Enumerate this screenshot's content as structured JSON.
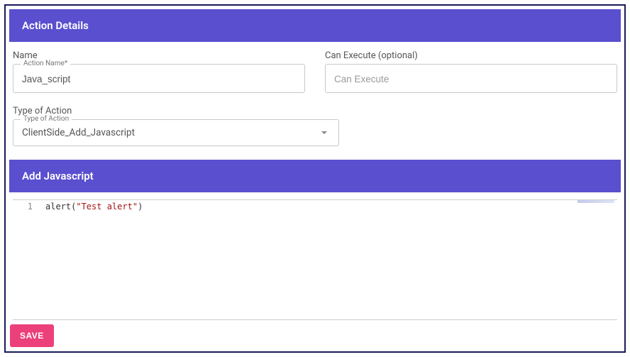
{
  "sections": {
    "details_title": "Action Details",
    "add_js_title": "Add Javascript"
  },
  "fields": {
    "name": {
      "label": "Name",
      "floating": "Action Name*",
      "value": "Java_script"
    },
    "can_execute": {
      "label": "Can Execute (optional)",
      "placeholder": "Can Execute",
      "value": ""
    },
    "type": {
      "label": "Type of Action",
      "floating": "Type of Action",
      "value": "ClientSide_Add_Javascript"
    }
  },
  "editor": {
    "line_number": "1",
    "code_fn": "alert",
    "code_open": "(",
    "code_str": "\"Test alert\"",
    "code_close": ")"
  },
  "buttons": {
    "save": "SAVE"
  }
}
